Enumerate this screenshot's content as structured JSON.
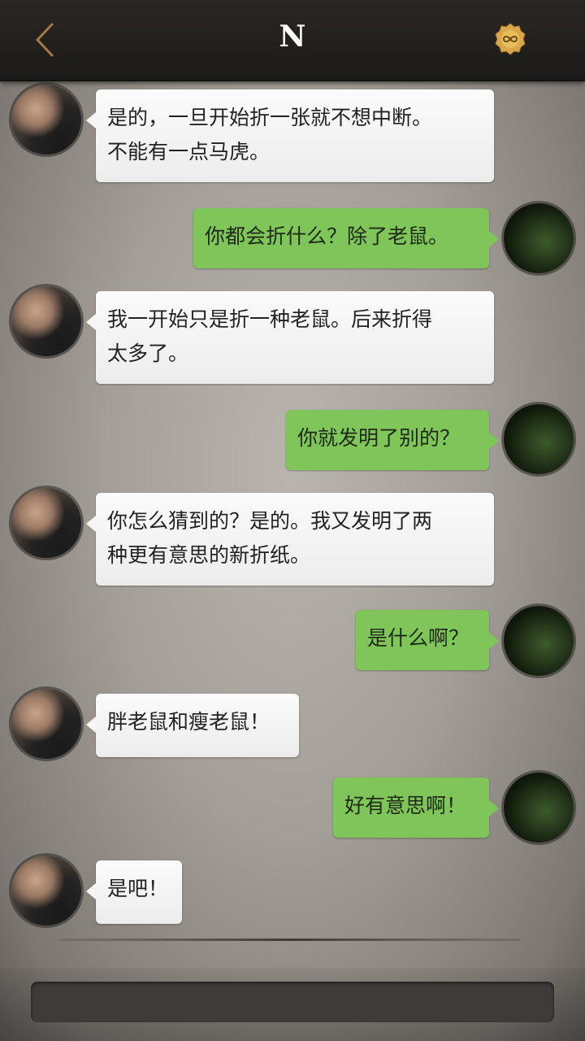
{
  "header": {
    "title": "N",
    "back_icon": "chevron-left-icon",
    "badge_icon": "infinity-badge-icon",
    "colors": {
      "back": "#a47a3e",
      "badge": "#d9a74a"
    }
  },
  "messages": [
    {
      "side": "left",
      "text": "是的，一旦开始折一张就不想中断。\n不能有一点马虎。"
    },
    {
      "side": "right",
      "text": "你都会折什么？除了老鼠。"
    },
    {
      "side": "left",
      "text": "我一开始只是折一种老鼠。后来折得\n太多了。"
    },
    {
      "side": "right",
      "text": "你就发明了别的？"
    },
    {
      "side": "left",
      "text": "你怎么猜到的？是的。我又发明了两\n种更有意思的新折纸。"
    },
    {
      "side": "right",
      "text": "是什么啊？"
    },
    {
      "side": "left",
      "text": "胖老鼠和瘦老鼠！"
    },
    {
      "side": "right",
      "text": "好有意思啊！"
    },
    {
      "side": "left",
      "text": "是吧！"
    }
  ],
  "composer": {
    "placeholder": ""
  },
  "colors": {
    "outgoing_bubble": "#7fc55a",
    "incoming_bubble": "#f4f4f4"
  }
}
